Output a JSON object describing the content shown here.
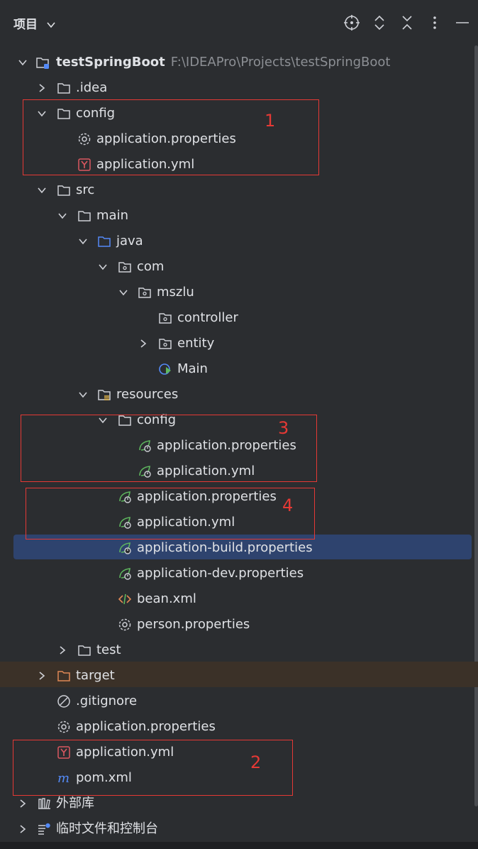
{
  "panel": {
    "title": "项目",
    "tools": [
      "locate-icon",
      "expand-all-icon",
      "collapse-all-icon",
      "more-icon",
      "minimize-icon"
    ]
  },
  "tree": {
    "root": {
      "name": "testSpringBoot",
      "path": "F:\\IDEAPro\\Projects\\testSpringBoot"
    },
    "items": [
      {
        "label": ".idea"
      },
      {
        "label": "config"
      },
      {
        "label": "application.properties"
      },
      {
        "label": "application.yml"
      },
      {
        "label": "src"
      },
      {
        "label": "main"
      },
      {
        "label": "java"
      },
      {
        "label": "com"
      },
      {
        "label": "mszlu"
      },
      {
        "label": "controller"
      },
      {
        "label": "entity"
      },
      {
        "label": "Main"
      },
      {
        "label": "resources"
      },
      {
        "label": "config"
      },
      {
        "label": "application.properties"
      },
      {
        "label": "application.yml"
      },
      {
        "label": "application.properties"
      },
      {
        "label": "application.yml"
      },
      {
        "label": "application-build.properties"
      },
      {
        "label": "application-dev.properties"
      },
      {
        "label": "bean.xml"
      },
      {
        "label": "person.properties"
      },
      {
        "label": "test"
      },
      {
        "label": "target"
      },
      {
        "label": ".gitignore"
      },
      {
        "label": "application.properties"
      },
      {
        "label": "application.yml"
      },
      {
        "label": "pom.xml"
      },
      {
        "label": "外部库"
      },
      {
        "label": "临时文件和控制台"
      }
    ]
  },
  "annotations": [
    "1",
    "2",
    "3",
    "4"
  ],
  "colors": {
    "accent_selection": "#2e436e",
    "annotation": "#e53935",
    "folder_java": "#548af7",
    "spring": "#5fb85f",
    "yaml": "#db5860"
  }
}
